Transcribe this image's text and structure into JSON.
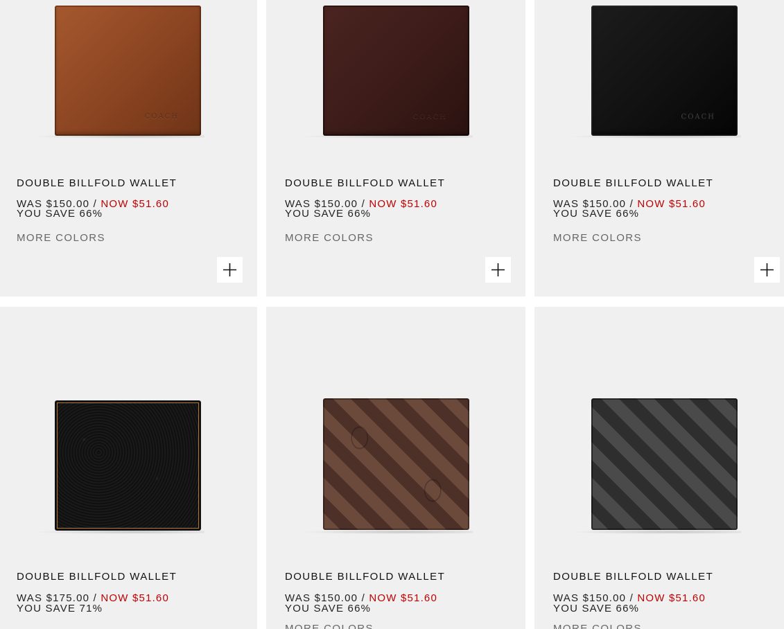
{
  "products": [
    {
      "name": "DOUBLE BILLFOLD WALLET",
      "was": "WAS $150.00 /",
      "now": "NOW $51.60",
      "save": "YOU SAVE 66%",
      "more": "MORE COLORS",
      "color": "saddle-brown-leather"
    },
    {
      "name": "DOUBLE BILLFOLD WALLET",
      "was": "WAS $150.00 /",
      "now": "NOW $51.60",
      "save": "YOU SAVE 66%",
      "more": "MORE COLORS",
      "color": "oxblood-leather"
    },
    {
      "name": "DOUBLE BILLFOLD WALLET",
      "was": "WAS $150.00 /",
      "now": "NOW $51.60",
      "save": "YOU SAVE 66%",
      "more": "MORE COLORS",
      "color": "black-leather"
    },
    {
      "name": "DOUBLE BILLFOLD WALLET",
      "was": "WAS $175.00 /",
      "now": "NOW $51.60",
      "save": "YOU SAVE 71%",
      "more": "",
      "color": "black-pebbled-leather"
    },
    {
      "name": "DOUBLE BILLFOLD WALLET",
      "was": "WAS $150.00 /",
      "now": "NOW $51.60",
      "save": "YOU SAVE 66%",
      "more": "MORE COLORS",
      "color": "brown-signature-canvas"
    },
    {
      "name": "DOUBLE BILLFOLD WALLET",
      "was": "WAS $150.00 /",
      "now": "NOW $51.60",
      "save": "YOU SAVE 66%",
      "more": "MORE COLORS",
      "color": "charcoal-signature-canvas"
    }
  ],
  "colors": {
    "sale": "#c00000",
    "card_bg": "#f0f0f0"
  },
  "icons": {
    "add": "plus-icon"
  }
}
